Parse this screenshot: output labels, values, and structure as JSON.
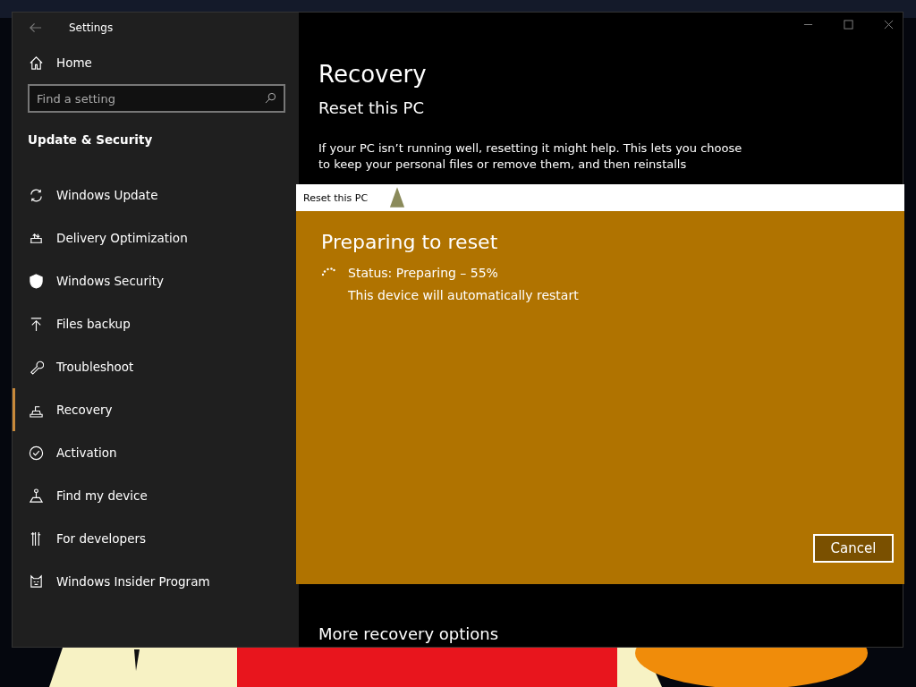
{
  "window": {
    "title": "Settings"
  },
  "sidebar": {
    "home": "Home",
    "search": {
      "placeholder": "Find a setting"
    },
    "section": "Update & Security",
    "items": [
      {
        "label": "Windows Update",
        "selected": false
      },
      {
        "label": "Delivery Optimization",
        "selected": false
      },
      {
        "label": "Windows Security",
        "selected": false
      },
      {
        "label": "Files backup",
        "selected": false
      },
      {
        "label": "Troubleshoot",
        "selected": false
      },
      {
        "label": "Recovery",
        "selected": true
      },
      {
        "label": "Activation",
        "selected": false
      },
      {
        "label": "Find my device",
        "selected": false
      },
      {
        "label": "For developers",
        "selected": false
      },
      {
        "label": "Windows Insider Program",
        "selected": false
      }
    ]
  },
  "main": {
    "title": "Recovery",
    "subtitle": "Reset this PC",
    "paragraph": [
      "If your PC isn’t running well, resetting it might help. This lets you choose",
      "to keep your personal files or remove them, and then reinstalls"
    ],
    "more": "More recovery options"
  },
  "dialog": {
    "title": "Reset this PC",
    "heading": "Preparing to reset",
    "status": "Status: Preparing – 55%",
    "note": "This device will automatically restart",
    "button": "Cancel"
  }
}
